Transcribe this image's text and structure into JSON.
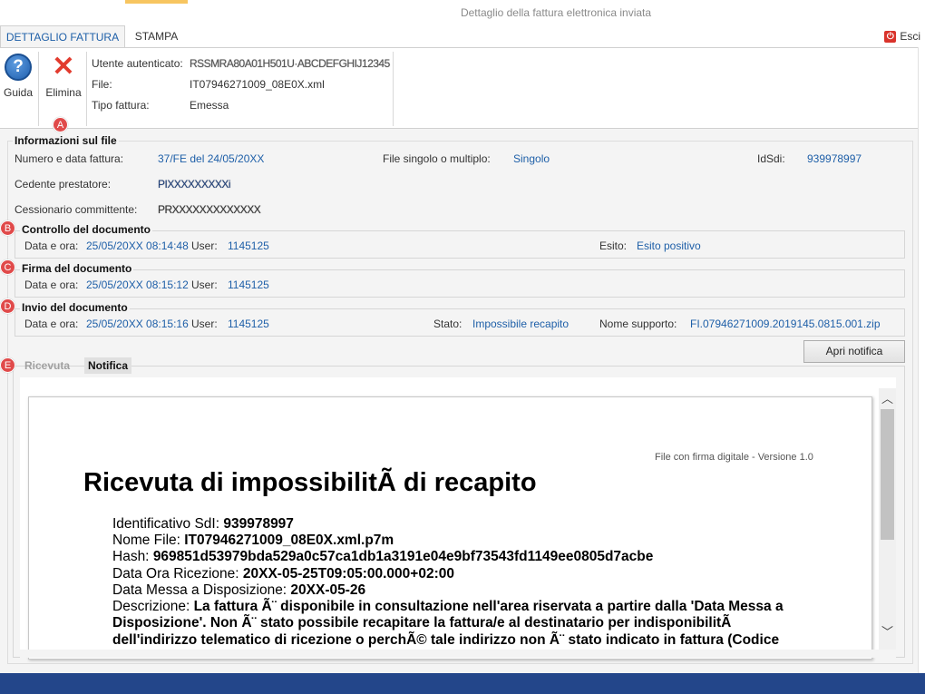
{
  "window": {
    "title": "Dettaglio della fattura elettronica inviata"
  },
  "tabs": {
    "dettaglio": "DETTAGLIO FATTURA",
    "stampa": "STAMPA"
  },
  "exit_label": "Esci",
  "toolbar": {
    "guida": "Guida",
    "elimina": "Elimina"
  },
  "info": {
    "utente_label": "Utente autenticato:",
    "utente_value": "RSSMRA80A01H501U·ABCDEFGHIJ12345",
    "file_label": "File:",
    "file_value": "IT07946271009_08E0X.xml",
    "tipo_label": "Tipo fattura:",
    "tipo_value": "Emessa"
  },
  "markers": {
    "a": "A",
    "b": "B",
    "c": "C",
    "d": "D",
    "e": "E"
  },
  "file_section": {
    "title": "Informazioni sul file",
    "numero_label": "Numero e data fattura:",
    "numero_value": "37/FE del 24/05/20XX",
    "singolo_label": "File singolo o multiplo:",
    "singolo_value": "Singolo",
    "idsdi_label": "IdSdi:",
    "idsdi_value": "939978997",
    "cedente_label": "Cedente prestatore:",
    "cedente_value": "PIXXXXXXXXXi",
    "cessionario_label": "Cessionario committente:",
    "cessionario_value": "PRXXXXXXXXXXXXX"
  },
  "controllo": {
    "title": "Controllo del documento",
    "data_label": "Data e ora:",
    "data_value": "25/05/20XX 08:14:48",
    "user_label": "User:",
    "user_value": "1145125",
    "esito_label": "Esito:",
    "esito_value": "Esito positivo"
  },
  "firma": {
    "title": "Firma del documento",
    "data_label": "Data e ora:",
    "data_value": "25/05/20XX 08:15:12",
    "user_label": "User:",
    "user_value": "1145125"
  },
  "invio": {
    "title": "Invio del documento",
    "data_label": "Data e ora:",
    "data_value": "25/05/20XX 08:15:16",
    "user_label": "User:",
    "user_value": "1145125",
    "stato_label": "Stato:",
    "stato_value": "Impossibile recapito",
    "supporto_label": "Nome supporto:",
    "supporto_value": "FI.07946271009.2019145.0815.001.zip"
  },
  "apri_notifica": "Apri notifica",
  "receipt_tabs": {
    "ricevuta": "Ricevuta",
    "notifica": "Notifica"
  },
  "document": {
    "version": "File con firma digitale - Versione 1.0",
    "title": "Ricevuta di impossibilitÃ  di recapito",
    "id_label": "Identificativo SdI: ",
    "id_value": "939978997",
    "nome_label": "Nome File: ",
    "nome_value": "IT07946271009_08E0X.xml.p7m",
    "hash_label": "Hash: ",
    "hash_value": "969851d53979bda529a0c57ca1db1a3191e04e9bf73543fd1149ee0805d7acbe",
    "ricezione_label": "Data Ora Ricezione: ",
    "ricezione_value": "20XX-05-25T09:05:00.000+02:00",
    "messa_label": "Data Messa a Disposizione: ",
    "messa_value": "20XX-05-26",
    "desc_label": "Descrizione: ",
    "desc_value": "La fattura Ã¨ disponibile in consultazione nell'area riservata a partire dalla 'Data Messa a Disposizione'. Non Ã¨ stato possibile recapitare la fattura/e al destinatario per indisponibilitÃ  dell'indirizzo telematico di ricezione o perchÃ© tale indirizzo non Ã¨ stato indicato in fattura (Codice"
  }
}
